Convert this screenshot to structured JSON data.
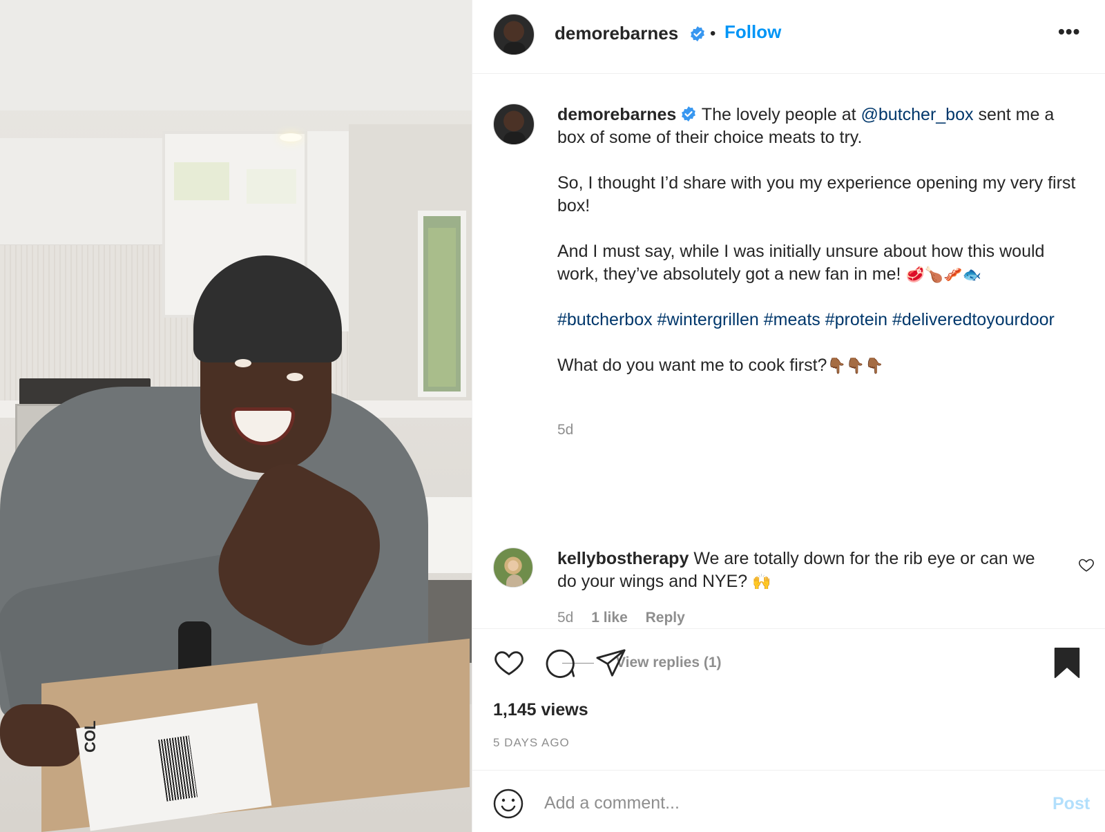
{
  "header": {
    "username": "demorebarnes",
    "dot": "•",
    "follow_label": "Follow",
    "more_label": "•••"
  },
  "caption": {
    "username": "demorebarnes",
    "intro": "The lovely people at",
    "mention": "@butcher_box",
    "intro_rest": "sent me a box of some of their choice meats to try.",
    "para2": "So, I thought I’d share with you my experience opening my very first box!",
    "para3": "And I must say, while I was initially unsure about how this would work, they’ve absolutely got a new fan in me!",
    "para3_emoji": "🥩🍗🥓🐟",
    "hashtags": "#butcherbox #wintergrillen #meats #protein #deliveredtoyourdoor",
    "question": "What do you want me to cook first?",
    "question_emoji": "👇🏾👇🏾👇🏾",
    "time": "5d"
  },
  "comment": {
    "username": "kellybostherapy",
    "text": "We are totally down for the rib eye or can we do your wings and NYE?",
    "emoji": "🙌",
    "time": "5d",
    "likes": "1 like",
    "reply_label": "Reply",
    "view_replies": "View replies (1)"
  },
  "post_meta": {
    "views": "1,145 views",
    "date": "5 DAYS AGO"
  },
  "add_comment": {
    "placeholder": "Add a comment...",
    "post_label": "Post"
  },
  "media": {
    "box_label": "COL"
  },
  "icons": {
    "like": "heart-icon",
    "comment": "comment-bubble-icon",
    "share": "paper-plane-icon",
    "save": "bookmark-icon",
    "emoji": "smiley-icon",
    "verified": "verified-badge-icon"
  },
  "colors": {
    "accent": "#0095f6",
    "link": "#00376b",
    "text": "#262626",
    "muted": "#8e8e8e",
    "post_disabled": "#b2dffc"
  }
}
